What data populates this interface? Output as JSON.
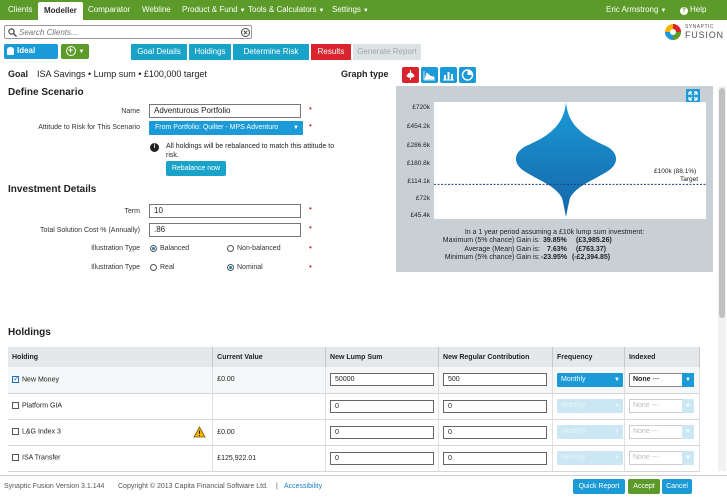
{
  "nav": {
    "items": [
      "Clients",
      "Modeller",
      "Comparator",
      "Webline",
      "Product & Fund",
      "Tools & Calculators",
      "Settings"
    ],
    "user": "Eric Armstrong",
    "help": "Help"
  },
  "search": {
    "placeholder": "Search Clients..."
  },
  "logo": {
    "small": "SYNAPTIC",
    "big": "FUSION"
  },
  "toolbar": {
    "client_button": "Ideal Client"
  },
  "breadcrumb": [
    "Goal Details",
    "Holdings",
    "Determine Risk Level",
    "Results",
    "Generate Report"
  ],
  "goal": {
    "label": "Goal",
    "text": "ISA Savings • Lump sum • £100,000 target"
  },
  "graph_type_label": "Graph type",
  "scenario": {
    "title": "Define Scenario",
    "name_label": "Name",
    "name_value": "Adventurous Portfolio",
    "risk_label": "Attitude to Risk for This Scenario",
    "risk_value": "From Portfolio: Quilter - MPS Adventuro",
    "info": "All holdings will be rebalanced to match this attitude to risk.",
    "rebalance_button": "Rebalance now"
  },
  "investment": {
    "title": "Investment Details",
    "term_label": "Term",
    "term_value": "10",
    "cost_label": "Total Solution Cost % (Annually)",
    "cost_value": ".86",
    "illus_label": "Illustration Type",
    "balanced": "Balanced",
    "nonbalanced": "Non-balanced",
    "real": "Real",
    "nominal": "Nominal"
  },
  "chart_data": {
    "type": "area",
    "y_ticks": [
      "£720k",
      "£454.2k",
      "£286.6k",
      "£180.8k",
      "£114.1k",
      "£72k",
      "£45.4k"
    ],
    "target_label": "£100k (88.1%)",
    "target_text": "Target",
    "target_value": 100000,
    "summary_title": "In a 1 year period assuming a £10k lump sum investment:",
    "summary": [
      {
        "label": "Maximum (5% chance) Gain is:",
        "pct": "39.85%",
        "amt": "(£3,985.26)"
      },
      {
        "label": "Average (Mean) Gain is:",
        "pct": "7.63%",
        "amt": "(£763.37)"
      },
      {
        "label": "Minimum (5% chance) Gain is:",
        "pct": "-23.95%",
        "amt": "(-£2,394.85)"
      }
    ]
  },
  "holdings": {
    "title": "Holdings",
    "headers": [
      "Holding",
      "Current Value",
      "New Lump Sum",
      "New Regular Contribution",
      "Frequency",
      "Indexed"
    ],
    "rows": [
      {
        "name": "New Money",
        "value": "£0.00",
        "lump": "50000",
        "regular": "500",
        "freq": "Monthly",
        "indexed": "None",
        "dash": "---"
      },
      {
        "name": "Platform GIA",
        "value": "",
        "lump": "0",
        "regular": "0",
        "freq": "Monthly",
        "indexed": "None",
        "dash": "---"
      },
      {
        "name": "L&G Index 3",
        "value": "£0.00",
        "lump": "0",
        "regular": "0",
        "freq": "Monthly",
        "indexed": "None",
        "dash": "---"
      },
      {
        "name": "ISA Transfer",
        "value": "£125,922.01",
        "lump": "0",
        "regular": "0",
        "freq": "Monthly",
        "indexed": "None",
        "dash": "---"
      }
    ]
  },
  "footer": {
    "version": "Synaptic Fusion Version 3.1.144",
    "copyright": "Copyright © 2013 Capita Financial Software Ltd.",
    "sep": "|",
    "accessibility": "Accessibility",
    "quick_report": "Quick Report",
    "accept": "Accept",
    "cancel": "Cancel"
  },
  "colors": {
    "nav_green": "#5c9a2a",
    "accent_blue": "#1a9ad6",
    "results_red": "#d9232d"
  }
}
